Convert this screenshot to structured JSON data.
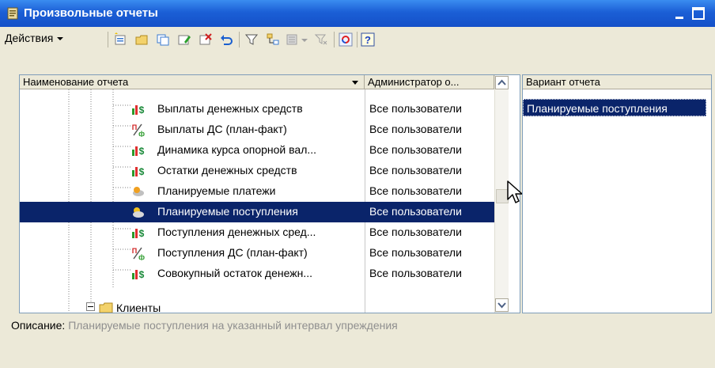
{
  "window": {
    "title": "Произвольные отчеты"
  },
  "toolbar": {
    "actions_label": "Действия"
  },
  "table": {
    "columns": {
      "name": "Наименование отчета",
      "admin": "Администратор о..."
    },
    "rows": [
      {
        "name": "Выплаты денежных средств",
        "admin": "Все пользователи",
        "icon": "report-money-icon"
      },
      {
        "name": "Выплаты ДС (план-факт)",
        "admin": "Все пользователи",
        "icon": "plan-fact-icon"
      },
      {
        "name": "Динамика курса опорной вал...",
        "admin": "Все пользователи",
        "icon": "report-money-icon"
      },
      {
        "name": "Остатки денежных средств",
        "admin": "Все пользователи",
        "icon": "report-money-icon"
      },
      {
        "name": "Планируемые платежи",
        "admin": "Все пользователи",
        "icon": "planned-payments-icon"
      },
      {
        "name": "Планируемые поступления",
        "admin": "Все пользователи",
        "icon": "planned-receipts-icon",
        "selected": true
      },
      {
        "name": "Поступления денежных сред...",
        "admin": "Все пользователи",
        "icon": "report-money-icon"
      },
      {
        "name": "Поступления ДС (план-факт)",
        "admin": "Все пользователи",
        "icon": "plan-fact-icon"
      },
      {
        "name": "Совокупный остаток денежн...",
        "admin": "Все пользователи",
        "icon": "report-money-icon"
      }
    ],
    "group": {
      "name": "Клиенты",
      "icon": "folder-icon"
    }
  },
  "variants": {
    "header": "Вариант отчета",
    "items": [
      "Планируемые поступления"
    ]
  },
  "description": {
    "label": "Описание:",
    "text": "Планируемые поступления на указанный интервал упреждения"
  },
  "colors": {
    "selection": "#0a246a",
    "titlebar": "#1b5fd6"
  }
}
